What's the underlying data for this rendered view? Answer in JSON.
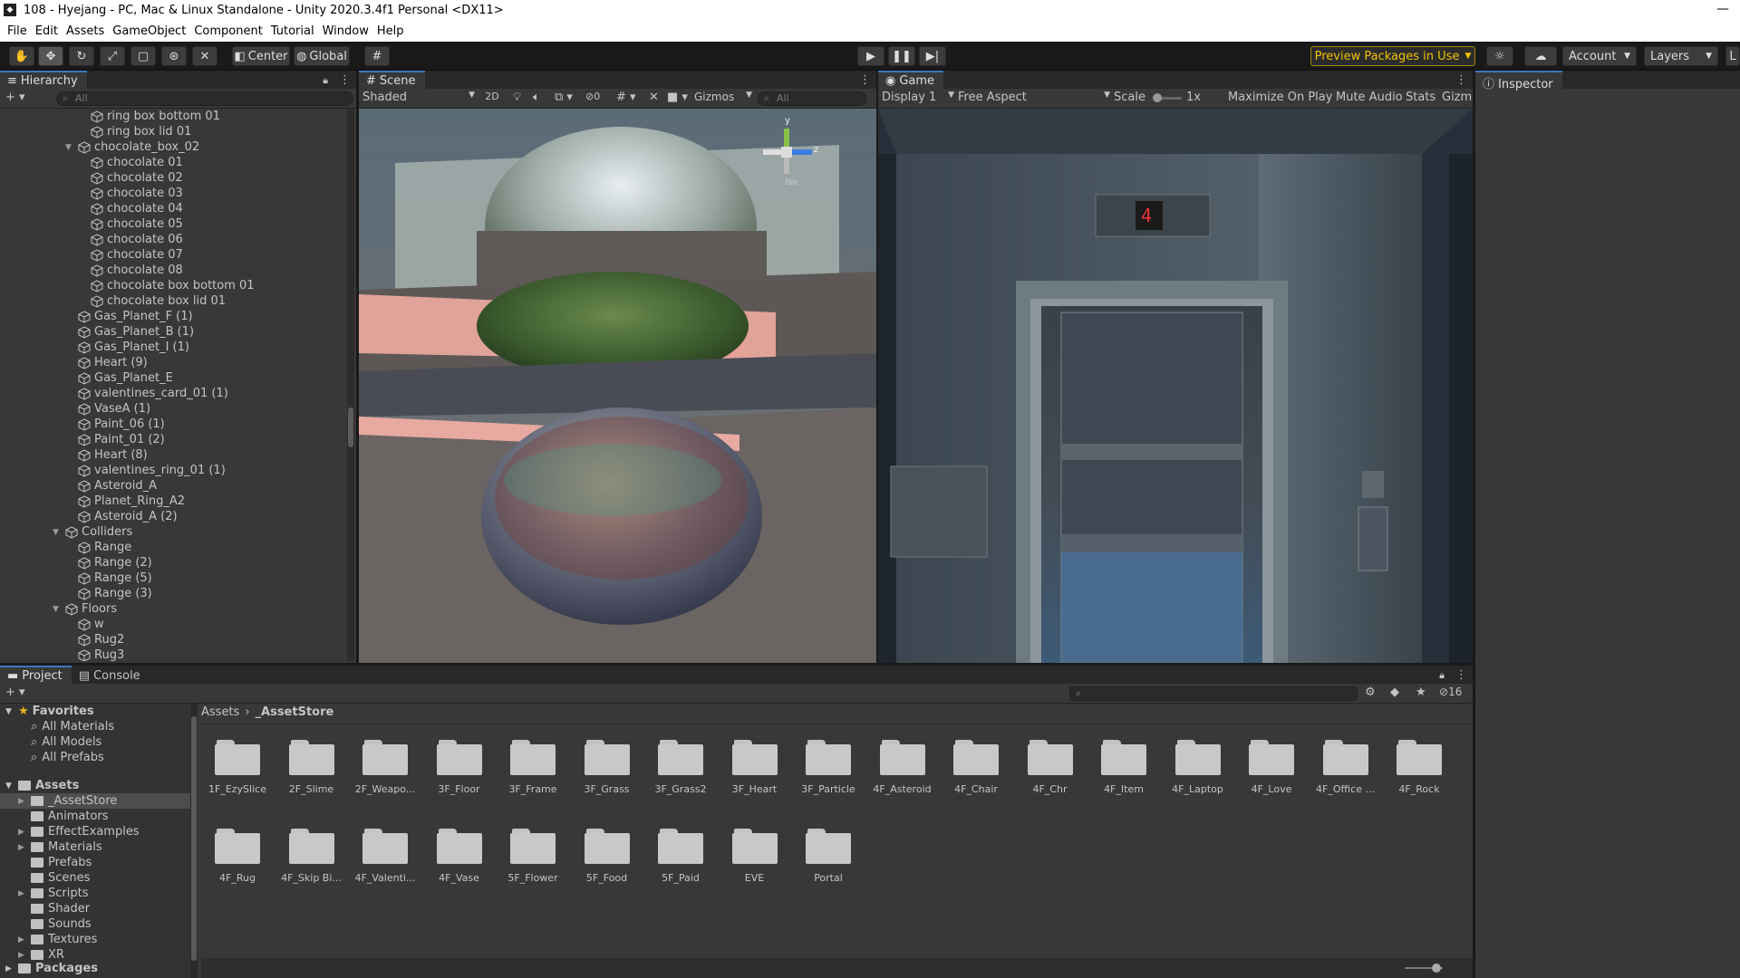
{
  "window": {
    "title": "108 - Hyejang - PC, Mac & Linux Standalone - Unity 2020.3.4f1 Personal <DX11>"
  },
  "menu": [
    "File",
    "Edit",
    "Assets",
    "GameObject",
    "Component",
    "Tutorial",
    "Window",
    "Help"
  ],
  "toolbar": {
    "pivot": "Center",
    "space": "Global",
    "preview_packages": "Preview Packages in Use",
    "account": "Account",
    "layers": "Layers",
    "layout_truncated": "L"
  },
  "hierarchy": {
    "tab": "Hierarchy",
    "search_placeholder": "All",
    "items": [
      {
        "label": "ring box bottom 01",
        "depth": 3,
        "arrow": ""
      },
      {
        "label": "ring box lid 01",
        "depth": 3,
        "arrow": ""
      },
      {
        "label": "chocolate_box_02",
        "depth": 2,
        "arrow": "▼"
      },
      {
        "label": "chocolate 01",
        "depth": 3,
        "arrow": ""
      },
      {
        "label": "chocolate 02",
        "depth": 3,
        "arrow": ""
      },
      {
        "label": "chocolate 03",
        "depth": 3,
        "arrow": ""
      },
      {
        "label": "chocolate 04",
        "depth": 3,
        "arrow": ""
      },
      {
        "label": "chocolate 05",
        "depth": 3,
        "arrow": ""
      },
      {
        "label": "chocolate 06",
        "depth": 3,
        "arrow": ""
      },
      {
        "label": "chocolate 07",
        "depth": 3,
        "arrow": ""
      },
      {
        "label": "chocolate 08",
        "depth": 3,
        "arrow": ""
      },
      {
        "label": "chocolate box bottom 01",
        "depth": 3,
        "arrow": ""
      },
      {
        "label": "chocolate box lid 01",
        "depth": 3,
        "arrow": ""
      },
      {
        "label": "Gas_Planet_F (1)",
        "depth": 2,
        "arrow": ""
      },
      {
        "label": "Gas_Planet_B (1)",
        "depth": 2,
        "arrow": ""
      },
      {
        "label": "Gas_Planet_I (1)",
        "depth": 2,
        "arrow": ""
      },
      {
        "label": "Heart (9)",
        "depth": 2,
        "arrow": ""
      },
      {
        "label": "Gas_Planet_E",
        "depth": 2,
        "arrow": ""
      },
      {
        "label": "valentines_card_01 (1)",
        "depth": 2,
        "arrow": ""
      },
      {
        "label": "VaseA (1)",
        "depth": 2,
        "arrow": ""
      },
      {
        "label": "Paint_06 (1)",
        "depth": 2,
        "arrow": ""
      },
      {
        "label": "Paint_01 (2)",
        "depth": 2,
        "arrow": ""
      },
      {
        "label": "Heart (8)",
        "depth": 2,
        "arrow": ""
      },
      {
        "label": "valentines_ring_01 (1)",
        "depth": 2,
        "arrow": ""
      },
      {
        "label": "Asteroid_A",
        "depth": 2,
        "arrow": ""
      },
      {
        "label": "Planet_Ring_A2",
        "depth": 2,
        "arrow": ""
      },
      {
        "label": "Asteroid_A (2)",
        "depth": 2,
        "arrow": ""
      },
      {
        "label": "Colliders",
        "depth": 1,
        "arrow": "▼"
      },
      {
        "label": "Range",
        "depth": 2,
        "arrow": ""
      },
      {
        "label": "Range (2)",
        "depth": 2,
        "arrow": ""
      },
      {
        "label": "Range (5)",
        "depth": 2,
        "arrow": ""
      },
      {
        "label": "Range (3)",
        "depth": 2,
        "arrow": ""
      },
      {
        "label": "Floors",
        "depth": 1,
        "arrow": "▼"
      },
      {
        "label": "w",
        "depth": 2,
        "arrow": ""
      },
      {
        "label": "Rug2",
        "depth": 2,
        "arrow": ""
      },
      {
        "label": "Rug3",
        "depth": 2,
        "arrow": ""
      }
    ]
  },
  "scene": {
    "tab": "Scene",
    "shading": "Shaded",
    "mode_2d": "2D",
    "hidden_count": "0",
    "gizmos": "Gizmos",
    "search_placeholder": "All",
    "gizmo_axes": {
      "y": "y",
      "z": "z"
    },
    "projection": "Iso"
  },
  "game": {
    "tab": "Game",
    "display": "Display 1",
    "aspect": "Free Aspect",
    "scale_label": "Scale",
    "scale_value": "1x",
    "maximize": "Maximize On Play",
    "mute": "Mute Audio",
    "stats": "Stats",
    "gizmos": "Gizm",
    "floor_display": "4"
  },
  "inspector": {
    "tab": "Inspector"
  },
  "project": {
    "tabs": [
      "Project",
      "Console"
    ],
    "hidden_count": "16",
    "breadcrumb": [
      "Assets",
      "_AssetStore"
    ],
    "favorites_label": "Favorites",
    "favorites": [
      "All Materials",
      "All Models",
      "All Prefabs"
    ],
    "assets_label": "Assets",
    "asset_folders": [
      {
        "label": "_AssetStore",
        "expand": true,
        "selected": true
      },
      {
        "label": "Animators",
        "expand": false
      },
      {
        "label": "EffectExamples",
        "expand": true
      },
      {
        "label": "Materials",
        "expand": true
      },
      {
        "label": "Prefabs",
        "expand": false
      },
      {
        "label": "Scenes",
        "expand": false
      },
      {
        "label": "Scripts",
        "expand": true
      },
      {
        "label": "Shader",
        "expand": false
      },
      {
        "label": "Sounds",
        "expand": false
      },
      {
        "label": "Textures",
        "expand": true
      },
      {
        "label": "XR",
        "expand": true
      }
    ],
    "packages_label": "Packages",
    "grid_folders": [
      "1F_EzySlice",
      "2F_Slime",
      "2F_Weapo...",
      "3F_Floor",
      "3F_Frame",
      "3F_Grass",
      "3F_Grass2",
      "3F_Heart",
      "3F_Particle",
      "4F_Asteroid",
      "4F_Chair",
      "4F_Chr",
      "4F_Item",
      "4F_Laptop",
      "4F_Love",
      "4F_Office ...",
      "4F_Rock",
      "4F_Rug",
      "4F_Skip Bi...",
      "4F_Valenti...",
      "4F_Vase",
      "5F_Flower",
      "5F_Food",
      "5F_Paid",
      "EVE",
      "Portal"
    ]
  }
}
